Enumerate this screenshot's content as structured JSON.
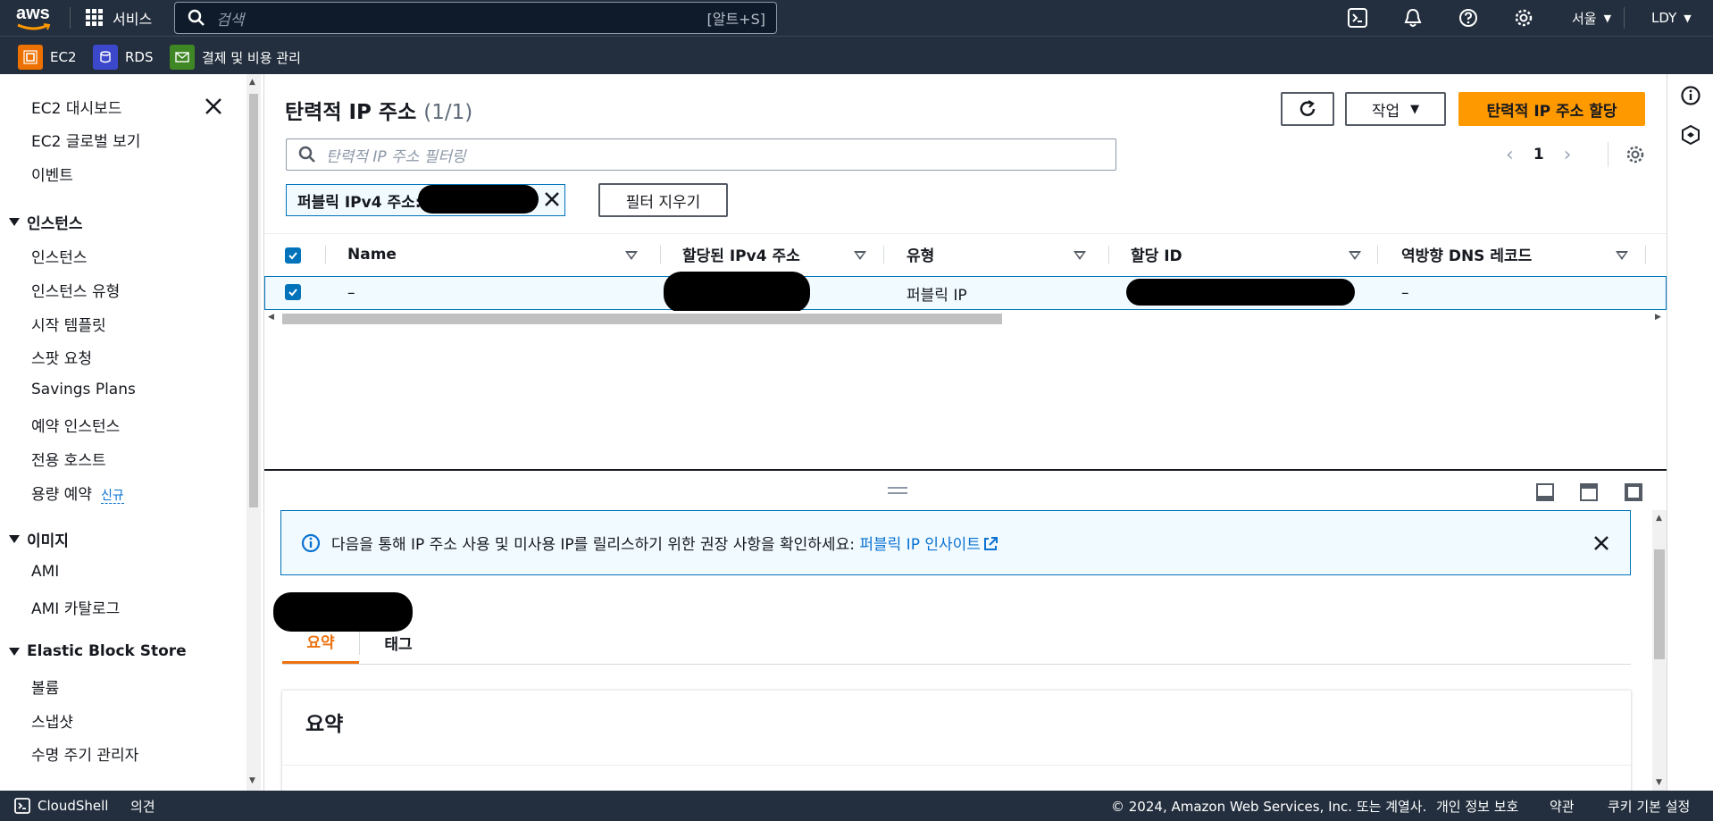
{
  "topnav": {
    "logo_text": "aws",
    "services_label": "서비스",
    "search_placeholder": "검색",
    "search_shortcut": "[알트+S]",
    "region": "서울",
    "user": "LDY"
  },
  "favorites": [
    {
      "label": "EC2",
      "color": "#ed7100"
    },
    {
      "label": "RDS",
      "color": "#3b48cc"
    },
    {
      "label": "결제 및 비용 관리",
      "color": "#3f8624"
    }
  ],
  "sidebar": {
    "top_items": [
      "EC2 대시보드",
      "EC2 글로벌 보기",
      "이벤트"
    ],
    "sections": [
      {
        "title": "인스턴스",
        "items": [
          "인스턴스",
          "인스턴스 유형",
          "시작 템플릿",
          "스팟 요청",
          "Savings Plans",
          "예약 인스턴스",
          "전용 호스트",
          "용량 예약"
        ]
      },
      {
        "title": "이미지",
        "items": [
          "AMI",
          "AMI 카탈로그"
        ]
      },
      {
        "title": "Elastic Block Store",
        "items": [
          "볼륨",
          "스냅샷",
          "수명 주기 관리자"
        ]
      }
    ],
    "new_badge": "신규"
  },
  "main": {
    "title": "탄력적 IP 주소",
    "count": "(1/1)",
    "actions_label": "작업",
    "allocate_label": "탄력적 IP 주소 할당",
    "filter_placeholder": "탄력적 IP 주소 필터링",
    "page_number": "1",
    "filter_token_label": "퍼블릭 IPv4 주소:",
    "clear_filter_label": "필터 지우기"
  },
  "table": {
    "columns": [
      "Name",
      "할당된 IPv4 주소",
      "유형",
      "할당 ID",
      "역방향 DNS 레코드"
    ],
    "rows": [
      {
        "name": "–",
        "type": "퍼블릭 IP",
        "reverse_dns": "–"
      }
    ]
  },
  "split_panel": {
    "info_text": "다음을 통해 IP 주소 사용 및 미사용 IP를 릴리스하기 위한 권장 사항을 확인하세요: ",
    "info_link": "퍼블릭 IP 인사이트",
    "tabs": [
      "요약",
      "태그"
    ],
    "summary_title": "요약"
  },
  "footer": {
    "cloudshell": "CloudShell",
    "feedback": "의견",
    "copyright": "© 2024, Amazon Web Services, Inc. 또는 계열사.",
    "privacy": "개인 정보 보호",
    "terms": "약관",
    "cookies": "쿠키 기본 설정"
  }
}
